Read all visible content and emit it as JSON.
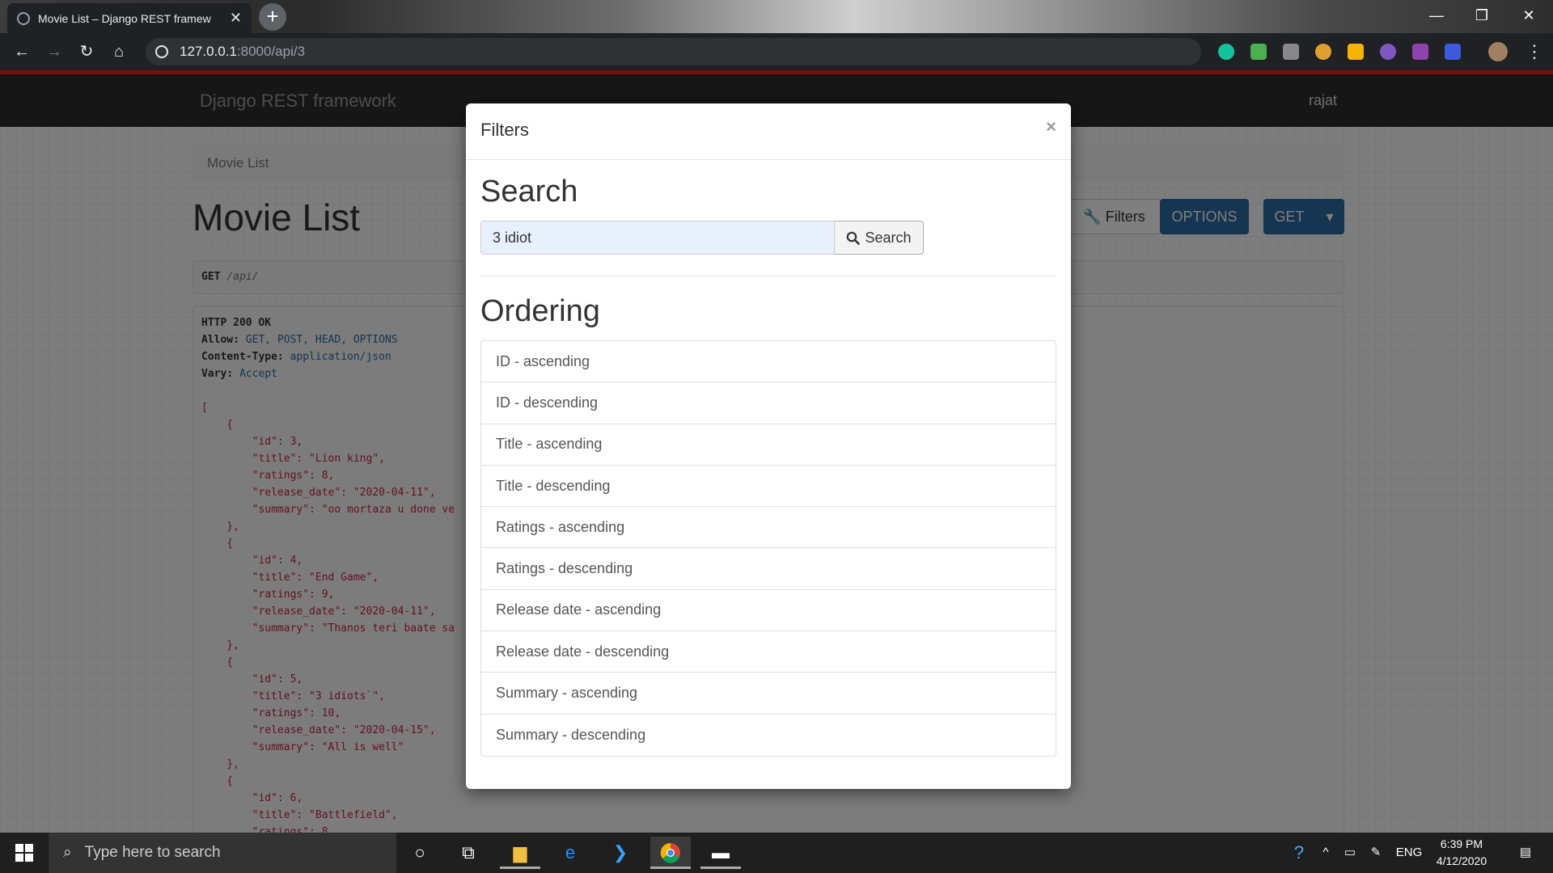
{
  "browser": {
    "tab_title": "Movie List – Django REST framew",
    "url_host": "127.0.0.1",
    "url_path": ":8000/api/3"
  },
  "page": {
    "brand": "Django REST framework",
    "user": "rajat",
    "breadcrumb": "Movie List",
    "title": "Movie List",
    "buttons": {
      "filters": "Filters",
      "options": "OPTIONS",
      "get": "GET"
    },
    "request": {
      "method": "GET",
      "path": "/api/"
    },
    "response_headers": [
      {
        "key": "HTTP 200 OK",
        "value": ""
      },
      {
        "key": "Allow:",
        "value": "GET, POST, HEAD, OPTIONS"
      },
      {
        "key": "Content-Type:",
        "value": "application/json"
      },
      {
        "key": "Vary:",
        "value": "Accept"
      }
    ],
    "response_lines": [
      "[",
      "    {",
      "        \"id\": 3,",
      "        \"title\": \"Lion king\",",
      "        \"ratings\": 8,",
      "        \"release_date\": \"2020-04-11\",",
      "        \"summary\": \"oo mortaza u done ve",
      "    },",
      "    {",
      "        \"id\": 4,",
      "        \"title\": \"End Game\",",
      "        \"ratings\": 9,",
      "        \"release_date\": \"2020-04-11\",",
      "        \"summary\": \"Thanos teri baate sa",
      "    },",
      "    {",
      "        \"id\": 5,",
      "        \"title\": \"3 idiots`\",",
      "        \"ratings\": 10,",
      "        \"release_date\": \"2020-04-15\",",
      "        \"summary\": \"All is well\"",
      "    },",
      "    {",
      "        \"id\": 6,",
      "        \"title\": \"Battlefield\",",
      "        \"ratings\": 8,"
    ]
  },
  "modal": {
    "title": "Filters",
    "close": "×",
    "search_heading": "Search",
    "search_value": "3 idiot",
    "search_button": "Search",
    "ordering_heading": "Ordering",
    "ordering": [
      "ID - ascending",
      "ID - descending",
      "Title - ascending",
      "Title - descending",
      "Ratings - ascending",
      "Ratings - descending",
      "Release date - ascending",
      "Release date - descending",
      "Summary - ascending",
      "Summary - descending"
    ]
  },
  "taskbar": {
    "search_placeholder": "Type here to search",
    "lang": "ENG",
    "time": "6:39 PM",
    "date": "4/12/2020"
  },
  "colors": {
    "primary": "#2c6aa3",
    "navbar": "#2c2c2c",
    "string": "#c7254e"
  }
}
